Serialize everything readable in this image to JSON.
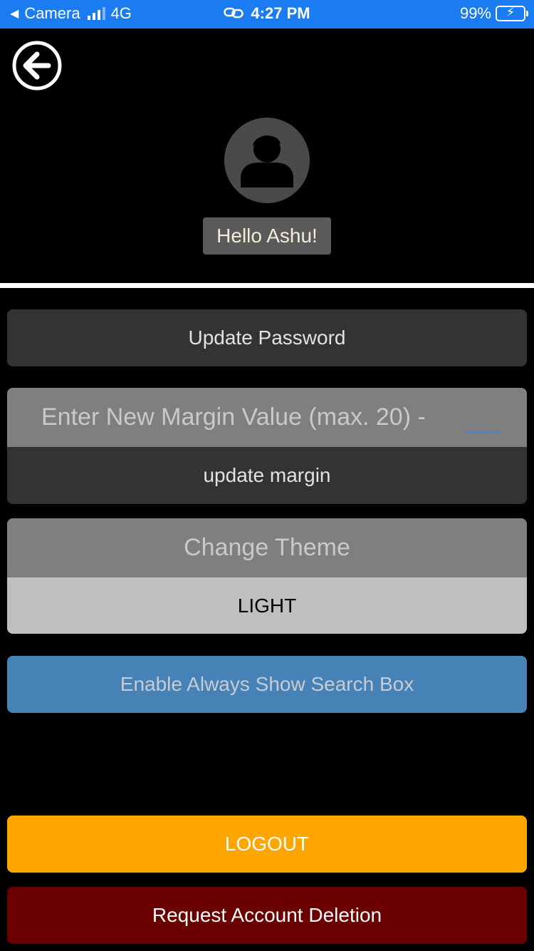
{
  "status_bar": {
    "back_app": "Camera",
    "network": "4G",
    "time": "4:27 PM",
    "battery": "99%",
    "battery_level": 0.99
  },
  "header": {
    "back_icon": "arrow-left-circle-icon",
    "avatar_icon": "user-avatar-icon",
    "greeting": "Hello Ashu!"
  },
  "settings": {
    "update_password": "Update Password",
    "margin_placeholder": "Enter New Margin Value (max. 20) -",
    "margin_value": "",
    "update_margin": "update margin",
    "change_theme": "Change Theme",
    "theme_value": "LIGHT",
    "search_box": "Enable Always Show Search Box"
  },
  "footer": {
    "logout": "LOGOUT",
    "delete_account": "Request Account Deletion"
  },
  "colors": {
    "status_bar": "#1a7cf0",
    "logout": "#ffa500",
    "delete": "#6b0000",
    "search_button": "#4682b6"
  }
}
